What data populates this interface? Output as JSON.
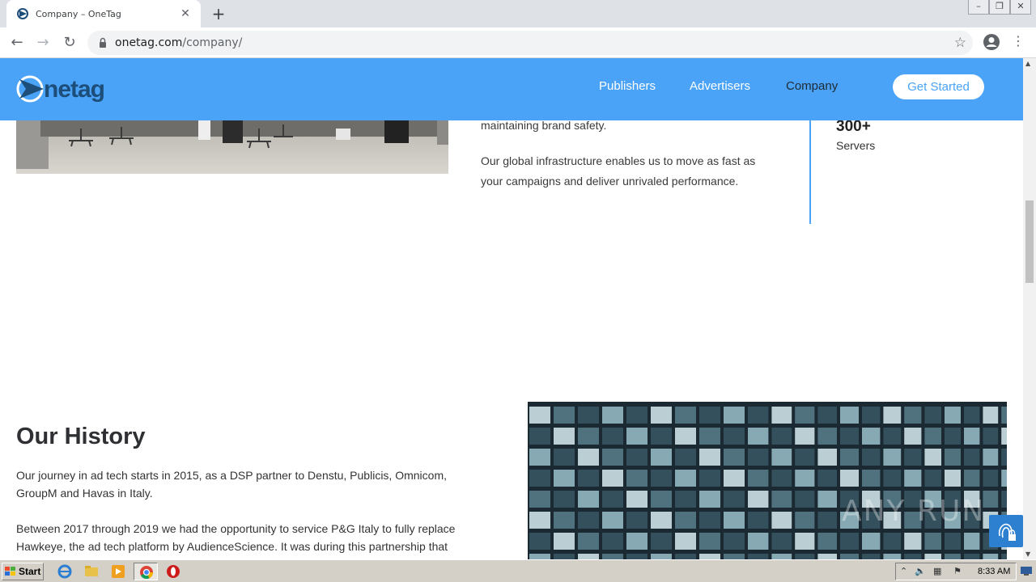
{
  "browser": {
    "tab_title": "Company – OneTag",
    "url_host": "onetag.com",
    "url_path": "/company/"
  },
  "site": {
    "logo_text": "Onetag",
    "nav": [
      {
        "label": "Publishers"
      },
      {
        "label": "Advertisers"
      },
      {
        "label": "Company",
        "active": true
      }
    ],
    "cta_label": "Get Started"
  },
  "content": {
    "para_top": "maintaining brand safety.",
    "para_infra_1": "Our global infrastructure enables us to move as fast as",
    "para_infra_2": "your campaigns and deliver unrivaled performance.",
    "stat_number": "300+",
    "stat_label": "Servers",
    "history_title": "Our History",
    "history_p1_l1": "Our journey in ad tech starts in 2015, as a DSP partner to Denstu, Publicis, Omnicom,",
    "history_p1_l2": "GroupM and Havas in Italy.",
    "history_p2_l1": "Between 2017 through 2019 we had the opportunity to service P&G Italy to fully replace",
    "history_p2_l2": "Hawkeye, the ad tech platform by AudienceScience. It was during this partnership that"
  },
  "overlay": {
    "watermark": "ANY RUN"
  },
  "taskbar": {
    "start_label": "Start",
    "clock": "8:33 AM"
  },
  "colors": {
    "brand_blue": "#4aa3f7",
    "nav_active": "#1f2a36"
  }
}
